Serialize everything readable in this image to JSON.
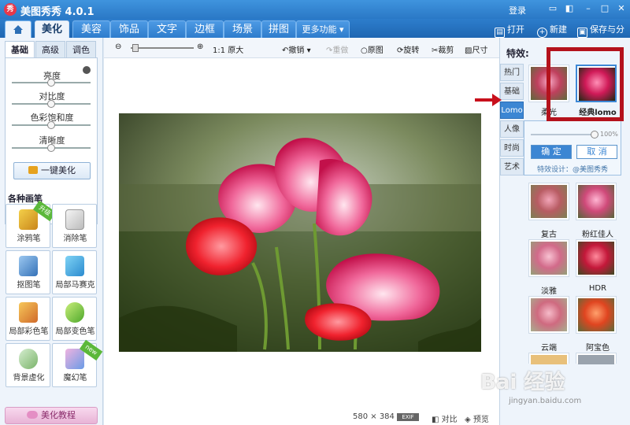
{
  "app": {
    "title": "美图秀秀 4.0.1",
    "logo": "秀",
    "login": "登录"
  },
  "nav": {
    "tabs": [
      "美化",
      "美容",
      "饰品",
      "文字",
      "边框",
      "场景",
      "拼图"
    ],
    "more": "更多功能",
    "open": "打开",
    "new": "新建",
    "save_share": "保存与分享"
  },
  "left": {
    "subtabs": [
      "基础",
      "高级",
      "调色"
    ],
    "adjustments": [
      "亮度",
      "对比度",
      "色彩饱和度",
      "清晰度"
    ],
    "adjustment_levels": [
      0.5,
      0.5,
      0.5,
      0.5
    ],
    "one_key": "一键美化",
    "brushes_title": "各种画笔",
    "brushes": [
      {
        "label": "涂鸦笔",
        "icon": "pencil-icon",
        "badge": "升级"
      },
      {
        "label": "消除笔",
        "icon": "eraser-icon",
        "badge": ""
      },
      {
        "label": "抠图笔",
        "icon": "cutout-pen-icon",
        "badge": ""
      },
      {
        "label": "局部马赛克",
        "icon": "mosaic-icon",
        "badge": ""
      },
      {
        "label": "局部彩色笔",
        "icon": "color-brush-icon",
        "badge": ""
      },
      {
        "label": "局部变色笔",
        "icon": "bucket-icon",
        "badge": ""
      },
      {
        "label": "背景虚化",
        "icon": "blur-icon",
        "badge": ""
      },
      {
        "label": "魔幻笔",
        "icon": "magic-pen-icon",
        "badge": "new"
      }
    ],
    "tutorial": "美化教程"
  },
  "toolbar": {
    "original_size": "1:1 原大",
    "undo": "撤销",
    "redo": "重做",
    "original": "原图",
    "rotate": "旋转",
    "crop": "裁剪",
    "resize": "尺寸"
  },
  "status": {
    "size": "580 × 384",
    "exif": "EXIF",
    "compare": "对比",
    "preview": "预览"
  },
  "right": {
    "title": "特效:",
    "categories": [
      "热门",
      "基础",
      "Lomo",
      "人像",
      "时尚",
      "艺术"
    ],
    "active_category": "Lomo",
    "top_effects": [
      "柔光",
      "经典lomo"
    ],
    "popup": {
      "percent": "100%",
      "ok": "确 定",
      "cancel": "取 消",
      "credit": "特效设计：@美图秀秀"
    },
    "grid_effects": [
      "复古",
      "粉红佳人",
      "淡雅",
      "HDR",
      "云端",
      "阿宝色"
    ]
  },
  "watermark": {
    "main": "Bai 经验",
    "sub": "jingyan.baidu.com"
  },
  "colors": {
    "titlebar": "#2a78c6",
    "highlight": "#b4121c",
    "accent": "#3c86d3"
  }
}
